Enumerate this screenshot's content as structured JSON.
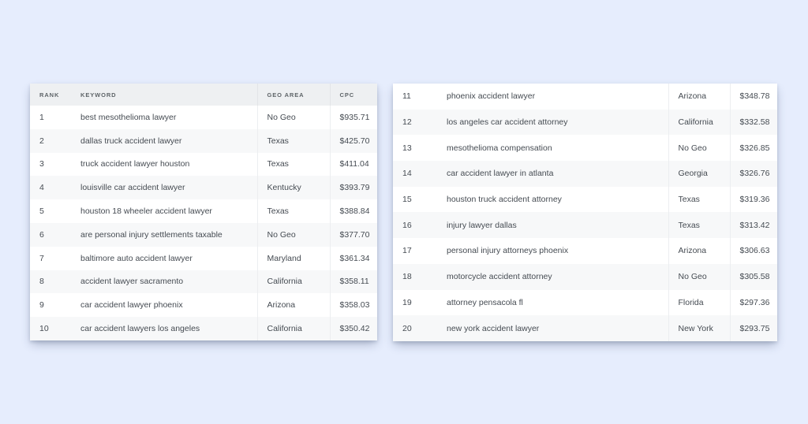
{
  "theme": {
    "page_background": "#e6edfd",
    "card_background": "#ffffff",
    "header_background": "#eef0f2",
    "zebra_row_background": "#f7f8f9",
    "text_color": "#454b52",
    "header_text_color": "#5e6468"
  },
  "left_table": {
    "name": "top-keywords-ranks-1-10",
    "has_header": true,
    "columns": [
      {
        "key": "rank",
        "label": "RANK"
      },
      {
        "key": "keyword",
        "label": "KEYWORD"
      },
      {
        "key": "geo",
        "label": "GEO AREA"
      },
      {
        "key": "cpc",
        "label": "CPC"
      }
    ],
    "rows": [
      {
        "rank": "1",
        "keyword": "best mesothelioma lawyer",
        "geo": "No Geo",
        "cpc": "$935.71"
      },
      {
        "rank": "2",
        "keyword": "dallas truck accident lawyer",
        "geo": "Texas",
        "cpc": "$425.70"
      },
      {
        "rank": "3",
        "keyword": "truck accident lawyer houston",
        "geo": "Texas",
        "cpc": "$411.04"
      },
      {
        "rank": "4",
        "keyword": "louisville car accident lawyer",
        "geo": "Kentucky",
        "cpc": "$393.79"
      },
      {
        "rank": "5",
        "keyword": "houston 18 wheeler accident lawyer",
        "geo": "Texas",
        "cpc": "$388.84"
      },
      {
        "rank": "6",
        "keyword": "are personal injury settlements taxable",
        "geo": "No Geo",
        "cpc": "$377.70"
      },
      {
        "rank": "7",
        "keyword": "baltimore auto accident lawyer",
        "geo": "Maryland",
        "cpc": "$361.34"
      },
      {
        "rank": "8",
        "keyword": "accident lawyer sacramento",
        "geo": "California",
        "cpc": "$358.11"
      },
      {
        "rank": "9",
        "keyword": "car accident lawyer phoenix",
        "geo": "Arizona",
        "cpc": "$358.03"
      },
      {
        "rank": "10",
        "keyword": "car accident lawyers los angeles",
        "geo": "California",
        "cpc": "$350.42"
      }
    ]
  },
  "right_table": {
    "name": "top-keywords-ranks-11-20",
    "has_header": false,
    "columns": [
      {
        "key": "rank",
        "label": ""
      },
      {
        "key": "keyword",
        "label": ""
      },
      {
        "key": "geo",
        "label": ""
      },
      {
        "key": "cpc",
        "label": ""
      }
    ],
    "rows": [
      {
        "rank": "11",
        "keyword": "phoenix accident lawyer",
        "geo": "Arizona",
        "cpc": "$348.78"
      },
      {
        "rank": "12",
        "keyword": "los angeles car accident attorney",
        "geo": "California",
        "cpc": "$332.58"
      },
      {
        "rank": "13",
        "keyword": "mesothelioma compensation",
        "geo": "No Geo",
        "cpc": "$326.85"
      },
      {
        "rank": "14",
        "keyword": "car accident lawyer in atlanta",
        "geo": "Georgia",
        "cpc": "$326.76"
      },
      {
        "rank": "15",
        "keyword": "houston truck accident attorney",
        "geo": "Texas",
        "cpc": "$319.36"
      },
      {
        "rank": "16",
        "keyword": "injury lawyer dallas",
        "geo": "Texas",
        "cpc": "$313.42"
      },
      {
        "rank": "17",
        "keyword": "personal injury attorneys phoenix",
        "geo": "Arizona",
        "cpc": "$306.63"
      },
      {
        "rank": "18",
        "keyword": "motorcycle accident attorney",
        "geo": "No Geo",
        "cpc": "$305.58"
      },
      {
        "rank": "19",
        "keyword": "attorney pensacola fl",
        "geo": "Florida",
        "cpc": "$297.36"
      },
      {
        "rank": "20",
        "keyword": "new york accident lawyer",
        "geo": "New York",
        "cpc": "$293.75"
      }
    ]
  }
}
